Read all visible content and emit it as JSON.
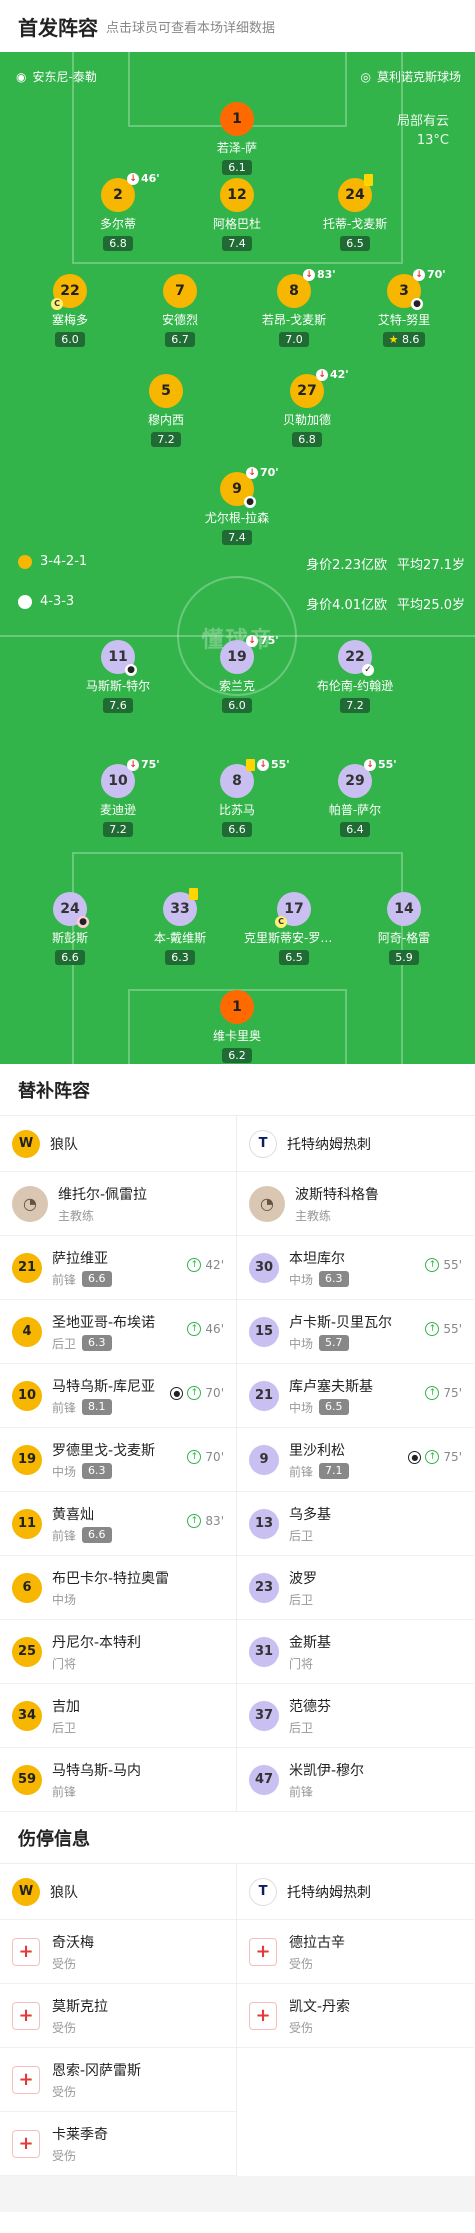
{
  "header": {
    "title": "首发阵容",
    "subtitle": "点击球员可查看本场详细数据"
  },
  "pitch": {
    "referee": "安东尼-泰勒",
    "stadium": "莫利诺克斯球场",
    "weather": "局部有云",
    "temperature": "13°C",
    "home_formation": "3-4-2-1",
    "home_value": "身价2.23亿欧",
    "home_age": "平均27.1岁",
    "away_formation": "4-3-3",
    "away_value": "身价4.01亿欧",
    "away_age": "平均25.0岁",
    "watermark": "懂球帝",
    "home_players": [
      {
        "num": "1",
        "name": "若泽-萨",
        "rating": "6.1"
      },
      {
        "num": "2",
        "name": "多尔蒂",
        "rating": "6.8",
        "sub": "46'"
      },
      {
        "num": "12",
        "name": "阿格巴杜",
        "rating": "7.4"
      },
      {
        "num": "24",
        "name": "托蒂-戈麦斯",
        "rating": "6.5"
      },
      {
        "num": "22",
        "name": "塞梅多",
        "rating": "6.0"
      },
      {
        "num": "7",
        "name": "安德烈",
        "rating": "6.7"
      },
      {
        "num": "8",
        "name": "若昂-戈麦斯",
        "rating": "7.0",
        "sub": "83'"
      },
      {
        "num": "3",
        "name": "艾特-努里",
        "rating": "8.6",
        "sub": "70'"
      },
      {
        "num": "5",
        "name": "穆内西",
        "rating": "7.2"
      },
      {
        "num": "27",
        "name": "贝勒加德",
        "rating": "6.8",
        "sub": "42'"
      },
      {
        "num": "9",
        "name": "尤尔根-拉森",
        "rating": "7.4",
        "sub": "70'"
      }
    ],
    "away_players": [
      {
        "num": "11",
        "name": "马斯斯-特尔",
        "rating": "7.6"
      },
      {
        "num": "19",
        "name": "索兰克",
        "rating": "6.0",
        "sub": "75'"
      },
      {
        "num": "22",
        "name": "布伦南-约翰逊",
        "rating": "7.2"
      },
      {
        "num": "10",
        "name": "麦迪逊",
        "rating": "7.2",
        "sub": "75'"
      },
      {
        "num": "8",
        "name": "比苏马",
        "rating": "6.6",
        "sub": "55'"
      },
      {
        "num": "29",
        "name": "帕普-萨尔",
        "rating": "6.4",
        "sub": "55'"
      },
      {
        "num": "24",
        "name": "斯彭斯",
        "rating": "6.6"
      },
      {
        "num": "33",
        "name": "本-戴维斯",
        "rating": "6.3"
      },
      {
        "num": "17",
        "name": "克里斯蒂安-罗梅罗",
        "rating": "6.5"
      },
      {
        "num": "14",
        "name": "阿奇-格雷",
        "rating": "5.9"
      },
      {
        "num": "1",
        "name": "维卡里奥",
        "rating": "6.2"
      }
    ]
  },
  "subs": {
    "title": "替补阵容",
    "home_team": "狼队",
    "away_team": "托特纳姆热刺",
    "home_coach": {
      "name": "维托尔-佩雷拉",
      "role": "主教练"
    },
    "away_coach": {
      "name": "波斯特科格鲁",
      "role": "主教练"
    },
    "home": [
      {
        "num": "21",
        "name": "萨拉维亚",
        "pos": "前锋",
        "rating": "6.6",
        "time": "42'"
      },
      {
        "num": "4",
        "name": "圣地亚哥-布埃诺",
        "pos": "后卫",
        "rating": "6.3",
        "time": "46'"
      },
      {
        "num": "10",
        "name": "马特乌斯-库尼亚",
        "pos": "前锋",
        "rating": "8.1",
        "time": "70'",
        "goal": true
      },
      {
        "num": "19",
        "name": "罗德里戈-戈麦斯",
        "pos": "中场",
        "rating": "6.3",
        "time": "70'"
      },
      {
        "num": "11",
        "name": "黄喜灿",
        "pos": "前锋",
        "rating": "6.6",
        "time": "83'"
      },
      {
        "num": "6",
        "name": "布巴卡尔-特拉奥雷",
        "pos": "中场"
      },
      {
        "num": "25",
        "name": "丹尼尔-本特利",
        "pos": "门将"
      },
      {
        "num": "34",
        "name": "吉加",
        "pos": "后卫"
      },
      {
        "num": "59",
        "name": "马特乌斯-马内",
        "pos": "前锋"
      }
    ],
    "away": [
      {
        "num": "30",
        "name": "本坦库尔",
        "pos": "中场",
        "rating": "6.3",
        "time": "55'"
      },
      {
        "num": "15",
        "name": "卢卡斯-贝里瓦尔",
        "pos": "中场",
        "rating": "5.7",
        "time": "55'"
      },
      {
        "num": "21",
        "name": "库卢塞夫斯基",
        "pos": "中场",
        "rating": "6.5",
        "time": "75'"
      },
      {
        "num": "9",
        "name": "里沙利松",
        "pos": "前锋",
        "rating": "7.1",
        "time": "75'",
        "goal": true
      },
      {
        "num": "13",
        "name": "乌多基",
        "pos": "后卫"
      },
      {
        "num": "23",
        "name": "波罗",
        "pos": "后卫"
      },
      {
        "num": "31",
        "name": "金斯基",
        "pos": "门将"
      },
      {
        "num": "37",
        "name": "范德芬",
        "pos": "后卫"
      },
      {
        "num": "47",
        "name": "米凯伊-穆尔",
        "pos": "前锋"
      }
    ]
  },
  "injuries": {
    "title": "伤停信息",
    "home_team": "狼队",
    "away_team": "托特纳姆热刺",
    "home": [
      {
        "name": "奇沃梅",
        "status": "受伤"
      },
      {
        "name": "莫斯克拉",
        "status": "受伤"
      },
      {
        "name": "恩索-冈萨雷斯",
        "status": "受伤"
      },
      {
        "name": "卡莱季奇",
        "status": "受伤"
      }
    ],
    "away": [
      {
        "name": "德拉古辛",
        "status": "受伤"
      },
      {
        "name": "凯文-丹索",
        "status": "受伤"
      }
    ]
  }
}
